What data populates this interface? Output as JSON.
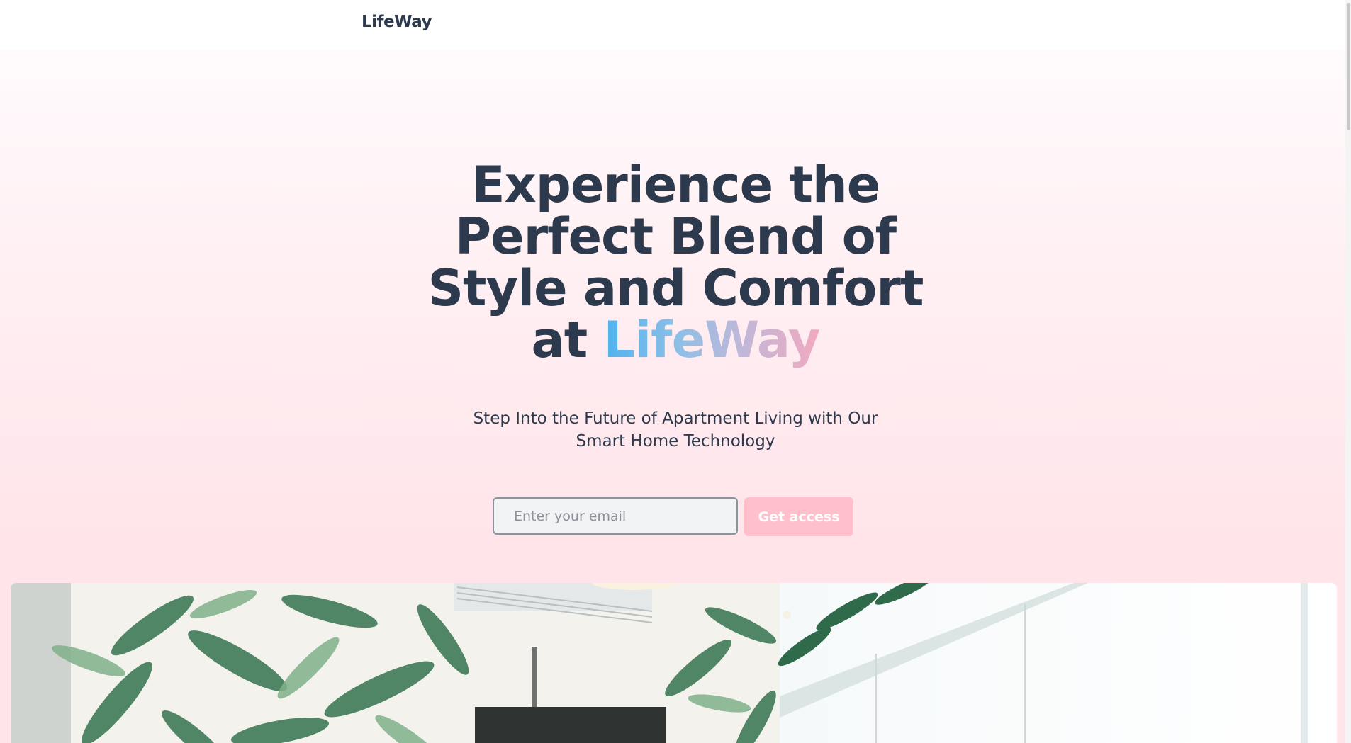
{
  "header": {
    "logo": "LifeWay"
  },
  "hero": {
    "headline_line1": "Experience the",
    "headline_line2": "Perfect Blend of",
    "headline_line3": "Style and Comfort",
    "headline_line4_prefix": "at",
    "headline_brand": "LifeWay",
    "subheadline": "Step Into the Future of Apartment Living with Our Smart Home Technology"
  },
  "signup": {
    "email_placeholder": "Enter your email",
    "email_value": "",
    "button_label": "Get access"
  },
  "colors": {
    "text_dark": "#2d3a4d",
    "button_bg": "#ffc0cc",
    "gradient_start": "#4fb3ef",
    "gradient_end": "#f2a9bf",
    "background_pink": "#ffe5ea"
  },
  "hero_image": {
    "alt": "Apartment interior with tropical leaf wallpaper"
  }
}
